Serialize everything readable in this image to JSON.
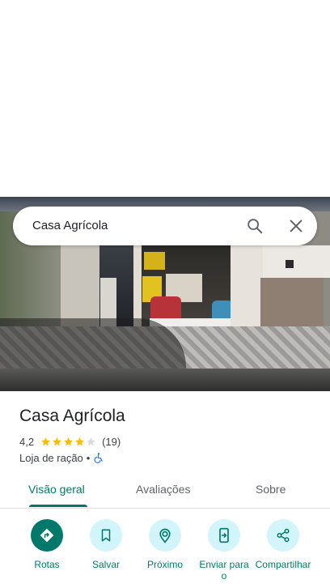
{
  "search": {
    "query": "Casa Agrícola"
  },
  "place": {
    "name": "Casa Agrícola",
    "rating": "4,2",
    "stars_value": 4.2,
    "review_count": "(19)",
    "category": "Loja de ração",
    "separator": "•"
  },
  "tabs": [
    {
      "label": "Visão geral",
      "active": true
    },
    {
      "label": "Avaliações",
      "active": false
    },
    {
      "label": "Sobre",
      "active": false
    }
  ],
  "actions": [
    {
      "label": "Rotas",
      "icon": "directions-icon"
    },
    {
      "label": "Salvar",
      "icon": "bookmark-icon"
    },
    {
      "label": "Próximo",
      "icon": "nearby-icon"
    },
    {
      "label": "Enviar para o",
      "icon": "send-to-phone-icon"
    },
    {
      "label": "Compartilhar",
      "icon": "share-icon"
    }
  ],
  "colors": {
    "accent": "#00796b",
    "action_bg": "#d2f4fb",
    "star": "#fbbc04",
    "star_empty": "#dadce0",
    "wheelchair": "#1a73e8"
  }
}
